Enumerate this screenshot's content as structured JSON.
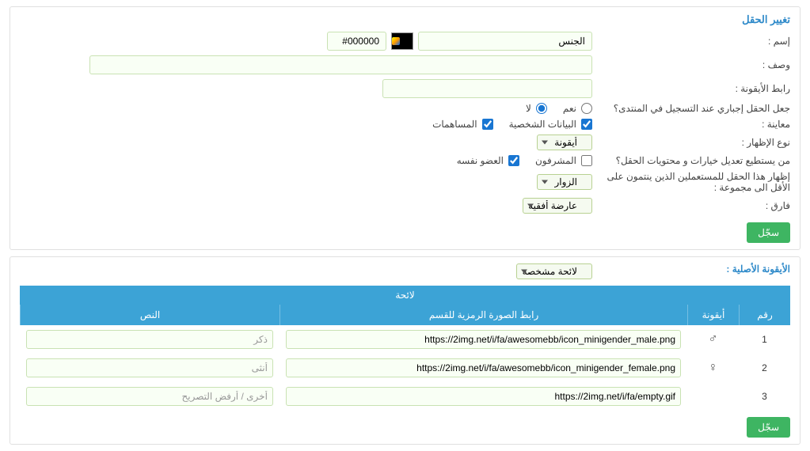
{
  "panel1": {
    "title": "تغيير الحقل",
    "labels": {
      "name": "إسم :",
      "desc": "وصف :",
      "icon_url": "رابط الأيقونة :",
      "required": "جعل الحقل إجباري عند التسجيل في المنتدى؟",
      "preview": "معاينة :",
      "display_type": "نوع الإظهار :",
      "who_edit": "من يستطيع تعديل خيارات و محتويات الحقل؟",
      "show_for_group": "إظهار هذا الحقل للمستعملين الذين ينتمون على الأقل الى مجموعة :",
      "separator": "فارق :"
    },
    "name_value": "الجنس",
    "color_value": "#000000",
    "radio_yes": "نعم",
    "radio_no": "لا",
    "chk_personal": "البيانات الشخصية",
    "chk_contrib": "المساهمات",
    "select_display": "أيقونة",
    "chk_mods": "المشرفون",
    "chk_self": "العضو نفسه",
    "select_group": "الزوار",
    "select_sep": "عارضة أفقية",
    "btn_save": "سجّل"
  },
  "panel2": {
    "title": "الأيقونة الأصلية :",
    "list_select": "لائحة مشخصة",
    "table_title": "لائحة",
    "headers": {
      "num": "رقم",
      "icon": "أيقونة",
      "url": "رابط الصورة الرمزية للقسم",
      "text": "النص"
    },
    "rows": [
      {
        "num": "1",
        "icon": "♂",
        "url": "https://2img.net/i/fa/awesomebb/icon_minigender_male.png",
        "text": "ذكر"
      },
      {
        "num": "2",
        "icon": "♀",
        "url": "https://2img.net/i/fa/awesomebb/icon_minigender_female.png",
        "text": "أنثى"
      },
      {
        "num": "3",
        "icon": "",
        "url": "https://2img.net/i/fa/empty.gif",
        "text": "أخرى / أرفض التصريح"
      }
    ],
    "btn_save": "سجّل"
  }
}
